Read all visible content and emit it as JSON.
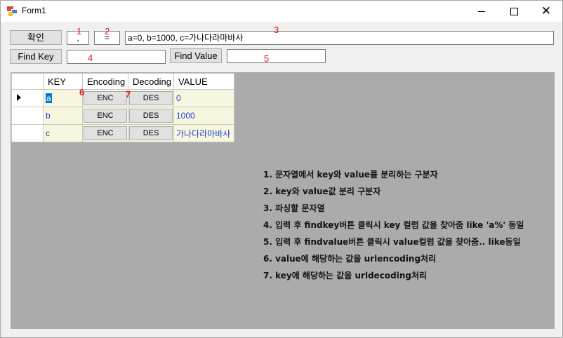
{
  "window": {
    "title": "Form1"
  },
  "controls": {
    "confirm_label": "확인",
    "separator1_value": ",",
    "separator2_value": "=",
    "parse_input_value": "a=0, b=1000, c=가나다라마바사",
    "find_key_label": "Find Key",
    "find_key_value": "",
    "find_value_label": "Find Value",
    "find_value_value": ""
  },
  "annotations": [
    "1",
    "2",
    "3",
    "4",
    "5",
    "6",
    "7"
  ],
  "grid": {
    "headers": [
      "KEY",
      "Encoding",
      "Decoding",
      "VALUE"
    ],
    "rows": [
      {
        "key": "a",
        "enc": "ENC",
        "dec": "DES",
        "value": "0"
      },
      {
        "key": "b",
        "enc": "ENC",
        "dec": "DES",
        "value": "1000"
      },
      {
        "key": "c",
        "enc": "ENC",
        "dec": "DES",
        "value": "가나다라마바사"
      }
    ]
  },
  "notes": [
    "1. 문자열에서 key와 value를 분리하는 구분자",
    "2. key와 value값 분리 구분자",
    "3. 파싱할 문자열",
    "4. 입력 후 findkey버튼 클릭시 key 컬럼 값을 찾아줌 like 'a%' 동일",
    "5. 입력 후 findvalue버튼 클릭시 value컬럼 값을 찾아줌.. like동일",
    "6. value에 해당하는 값을 urlencoding처리",
    "7. key에 해당하는 값을 urldecoding처리"
  ],
  "colors": {
    "grid_background": "#ababab",
    "cell_background": "#f7f7e0",
    "cell_text": "#1f3ed0",
    "annotation": "#e01818",
    "selection": "#0078d7"
  }
}
